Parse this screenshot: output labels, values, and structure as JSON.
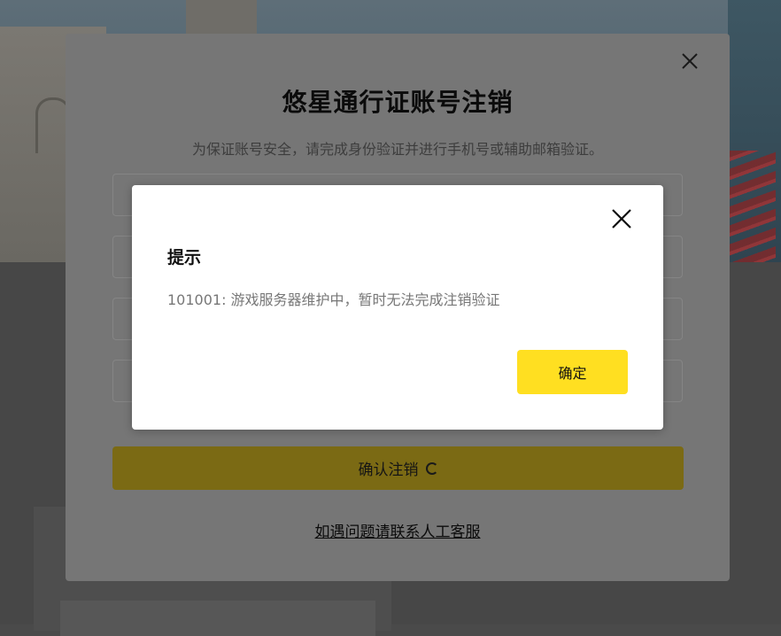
{
  "outer_modal": {
    "title": "悠星通行证账号注销",
    "subtitle": "为保证账号安全，请完成身份验证并进行手机号或辅助邮箱验证。",
    "confirm_button_label": "确认注销",
    "support_link": "如遇问题请联系人工客服",
    "close_icon": "close-icon"
  },
  "dialog": {
    "title": "提示",
    "message": "101001: 游戏服务器维护中，暂时无法完成注销验证",
    "ok_label": "确定",
    "close_icon": "close-icon"
  },
  "colors": {
    "accent": "#ffdf21",
    "overlay_button": "#7b6a14",
    "dialog_bg": "#ffffff"
  }
}
